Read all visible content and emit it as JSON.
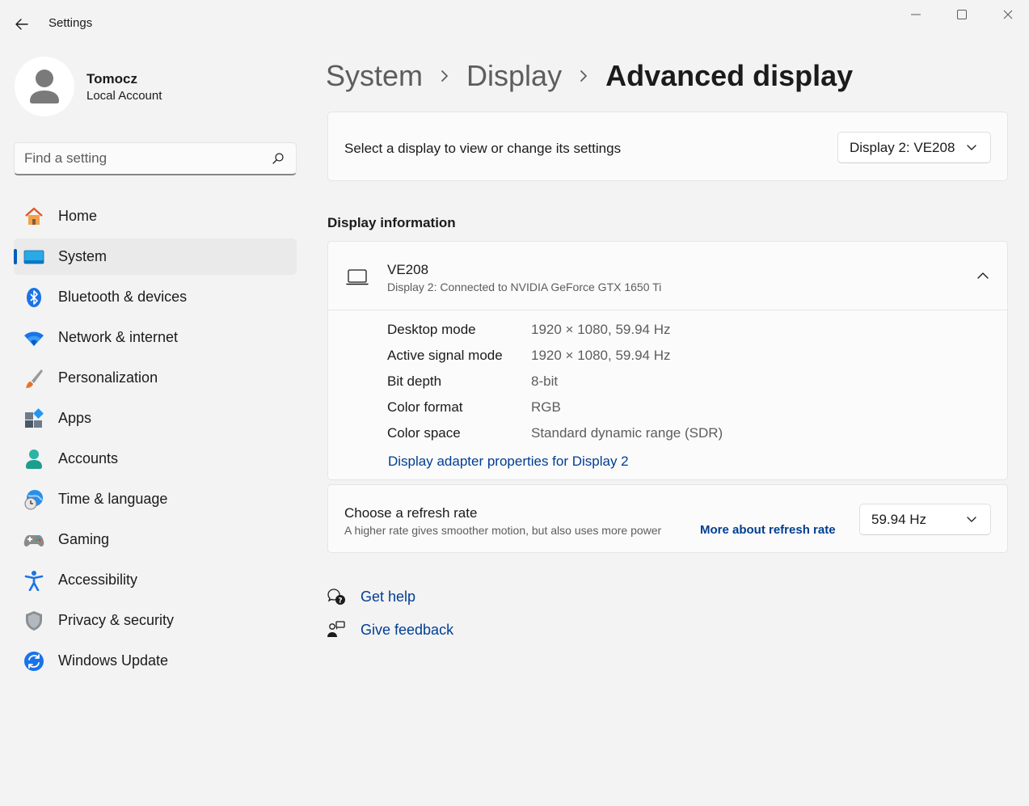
{
  "window": {
    "title": "Settings"
  },
  "profile": {
    "name": "Tomocz",
    "account_type": "Local Account"
  },
  "search": {
    "placeholder": "Find a setting",
    "value": ""
  },
  "sidebar": {
    "items": [
      {
        "label": "Home",
        "icon": "home-icon",
        "selected": false
      },
      {
        "label": "System",
        "icon": "system-icon",
        "selected": true
      },
      {
        "label": "Bluetooth & devices",
        "icon": "bluetooth-icon",
        "selected": false
      },
      {
        "label": "Network & internet",
        "icon": "wifi-icon",
        "selected": false
      },
      {
        "label": "Personalization",
        "icon": "brush-icon",
        "selected": false
      },
      {
        "label": "Apps",
        "icon": "apps-icon",
        "selected": false
      },
      {
        "label": "Accounts",
        "icon": "accounts-icon",
        "selected": false
      },
      {
        "label": "Time & language",
        "icon": "time-language-icon",
        "selected": false
      },
      {
        "label": "Gaming",
        "icon": "gamepad-icon",
        "selected": false
      },
      {
        "label": "Accessibility",
        "icon": "accessibility-icon",
        "selected": false
      },
      {
        "label": "Privacy & security",
        "icon": "shield-icon",
        "selected": false
      },
      {
        "label": "Windows Update",
        "icon": "update-icon",
        "selected": false
      }
    ]
  },
  "breadcrumb": {
    "items": [
      "System",
      "Display"
    ],
    "current": "Advanced display"
  },
  "display_select": {
    "label": "Select a display to view or change its settings",
    "selected": "Display 2: VE208"
  },
  "display_info": {
    "section_title": "Display information",
    "name": "VE208",
    "subtitle": "Display 2: Connected to NVIDIA GeForce GTX 1650 Ti",
    "rows": [
      {
        "key": "Desktop mode",
        "value": "1920 × 1080, 59.94 Hz"
      },
      {
        "key": "Active signal mode",
        "value": "1920 × 1080, 59.94 Hz"
      },
      {
        "key": "Bit depth",
        "value": "8-bit"
      },
      {
        "key": "Color format",
        "value": "RGB"
      },
      {
        "key": "Color space",
        "value": "Standard dynamic range (SDR)"
      }
    ],
    "adapter_link": "Display adapter properties for Display 2"
  },
  "refresh_rate": {
    "title": "Choose a refresh rate",
    "description": "A higher rate gives smoother motion, but also uses more power",
    "link": "More about refresh rate",
    "selected": "59.94 Hz"
  },
  "help": {
    "get_help": "Get help",
    "give_feedback": "Give feedback"
  },
  "colors": {
    "accent": "#005fb8",
    "link": "#003e92",
    "background": "#f3f3f3",
    "card": "#fbfbfb"
  }
}
